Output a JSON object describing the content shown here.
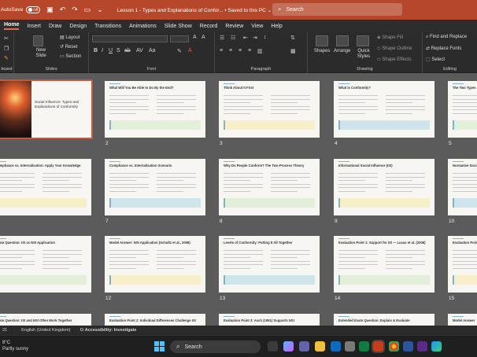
{
  "titlebar": {
    "autosave": "AutoSave",
    "toggle": "Off",
    "doc_title": "Lesson 1 - Types and Explanations of Confor...  •  Saved to this PC ⌄",
    "search_placeholder": "Search"
  },
  "tabs": [
    "Home",
    "Insert",
    "Draw",
    "Design",
    "Transitions",
    "Animations",
    "Slide Show",
    "Record",
    "Review",
    "View",
    "Help"
  ],
  "ribbon": {
    "clipboard_label": "board",
    "slides_label": "Slides",
    "font_label": "Font",
    "paragraph_label": "Paragraph",
    "drawing_label": "Drawing",
    "editing_label": "Editing",
    "new_slide": "New Slide",
    "layout": "Layout",
    "reset": "Reset",
    "section": "Section",
    "shapes": "Shapes",
    "arrange": "Arrange",
    "quick_styles": "Quick Styles",
    "shape_fill": "Shape Fill",
    "shape_outline": "Shape Outline",
    "shape_effects": "Shape Effects",
    "find_replace": "Find and Replace",
    "replace_fonts": "Replace Fonts",
    "select": "Select"
  },
  "slides": [
    {
      "num": "",
      "title": "Social Influence: Types and Explanations of Conformity",
      "col": 0,
      "row": 0,
      "selected": true,
      "cover": true
    },
    {
      "num": "2",
      "title": "What Will You Be Able to Do By the End?",
      "col": 1,
      "row": 0
    },
    {
      "num": "3",
      "title": "Think About It First",
      "col": 2,
      "row": 0
    },
    {
      "num": "4",
      "title": "What is Conformity?",
      "col": 3,
      "row": 0
    },
    {
      "num": "5",
      "title": "The Two Types",
      "col": 4,
      "row": 0
    },
    {
      "num": "",
      "title": "Compliance vs. Internalisation: Apply Your Knowledge",
      "col": 0,
      "row": 1
    },
    {
      "num": "7",
      "title": "Compliance vs. Internalisation Scenario",
      "col": 1,
      "row": 1
    },
    {
      "num": "8",
      "title": "Why Do People Conform? The Two-Process Theory",
      "col": 2,
      "row": 1
    },
    {
      "num": "9",
      "title": "Informational Social Influence (ISI)",
      "col": 3,
      "row": 1
    },
    {
      "num": "10",
      "title": "Normative Social",
      "col": 4,
      "row": 1
    },
    {
      "num": "",
      "title": "Exam Question: ISI vs NSI Application",
      "col": 0,
      "row": 2
    },
    {
      "num": "12",
      "title": "Model Answer: NSI Application (Schultz et al., 2008)",
      "col": 1,
      "row": 2
    },
    {
      "num": "13",
      "title": "Levels of Conformity: Putting It All Together",
      "col": 2,
      "row": 2
    },
    {
      "num": "14",
      "title": "Evaluation Point 1: Support for ISI — Lucas et al. (2006)",
      "col": 3,
      "row": 2
    },
    {
      "num": "15",
      "title": "Evaluation Point",
      "col": 4,
      "row": 2
    },
    {
      "num": "",
      "title": "Exam Question: ISI and NSI Often Work Together",
      "col": 0,
      "row": 3
    },
    {
      "num": "",
      "title": "Evaluation Point 2: Individual Differences Challenge ISI",
      "col": 1,
      "row": 3
    },
    {
      "num": "",
      "title": "Evaluation Point 3: Asch (1951) Supports NSI",
      "col": 2,
      "row": 3
    },
    {
      "num": "",
      "title": "Extended Exam Question: Explain & Evaluate",
      "col": 3,
      "row": 3
    },
    {
      "num": "",
      "title": "Model Answer",
      "col": 4,
      "row": 3
    }
  ],
  "status": {
    "slide": "21",
    "language": "English (United Kingdom)",
    "accessibility": "Accessibility: Investigate"
  },
  "taskbar": {
    "temp": "8°C",
    "weather": "Partly sunny",
    "search": "Search"
  },
  "colors": {
    "accent": "#b7472a",
    "selection": "#c55a3b",
    "teal_box": "#cfe5ec",
    "green_box": "#e3efd8",
    "yellow_box": "#f6efc9"
  }
}
